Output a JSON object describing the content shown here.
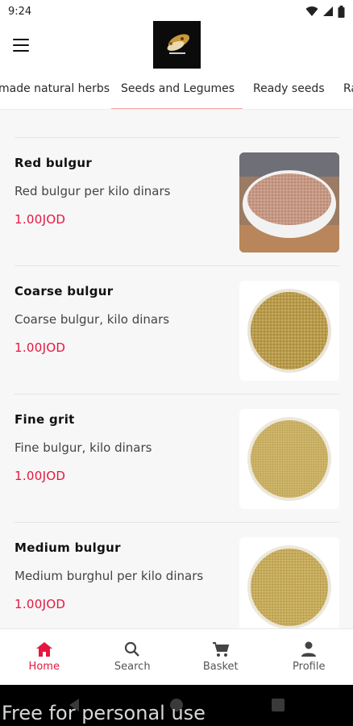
{
  "status": {
    "time": "9:24"
  },
  "tabs": [
    {
      "label": "made natural herbs"
    },
    {
      "label": "Seeds and Legumes"
    },
    {
      "label": "Ready seeds"
    },
    {
      "label": "Ra"
    }
  ],
  "products": [
    {
      "name": "Red bulgur",
      "desc": "Red bulgur per kilo dinars",
      "price": "1.00JOD",
      "image": "red-bulgur-bowl"
    },
    {
      "name": "Coarse bulgur",
      "desc": "Coarse bulgur, kilo dinars",
      "price": "1.00JOD",
      "image": "coarse-bulgur-plate"
    },
    {
      "name": "Fine grit",
      "desc": "Fine bulgur, kilo dinars",
      "price": "1.00JOD",
      "image": "fine-bulgur-plate"
    },
    {
      "name": "Medium bulgur",
      "desc": "Medium burghul per kilo dinars",
      "price": "1.00JOD",
      "image": "medium-bulgur-plate"
    }
  ],
  "nav": {
    "home": "Home",
    "search": "Search",
    "basket": "Basket",
    "profile": "Profile"
  },
  "watermark": "Free for personal use",
  "colors": {
    "accent": "#e5173f",
    "tab_indicator": "#f4a3a3"
  }
}
